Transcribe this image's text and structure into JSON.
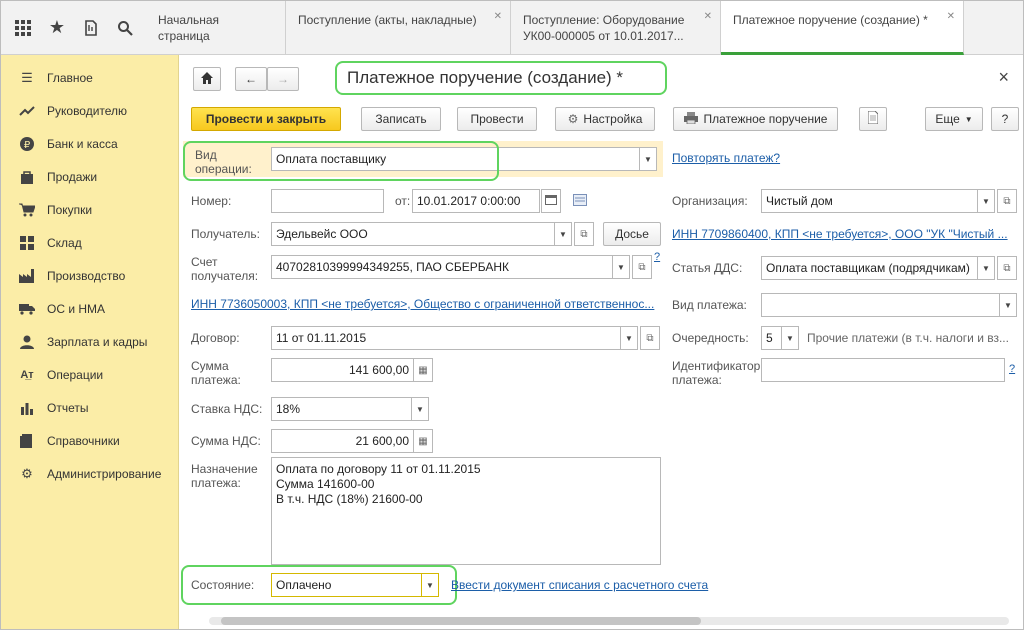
{
  "tabs": [
    {
      "label": "Начальная страница"
    },
    {
      "label": "Поступление (акты, накладные)"
    },
    {
      "label": "Поступление: Оборудование УК00-000005 от 10.01.2017..."
    },
    {
      "label": "Платежное поручение (создание) *"
    }
  ],
  "sidebar": {
    "items": [
      {
        "label": "Главное",
        "icon": "menu-icon"
      },
      {
        "label": "Руководителю",
        "icon": "trend-icon"
      },
      {
        "label": "Банк и касса",
        "icon": "ruble-icon"
      },
      {
        "label": "Продажи",
        "icon": "bag-icon"
      },
      {
        "label": "Покупки",
        "icon": "cart-icon"
      },
      {
        "label": "Склад",
        "icon": "grid-icon"
      },
      {
        "label": "Производство",
        "icon": "factory-icon"
      },
      {
        "label": "ОС и НМА",
        "icon": "truck-icon"
      },
      {
        "label": "Зарплата и кадры",
        "icon": "person-icon"
      },
      {
        "label": "Операции",
        "icon": "operations-icon"
      },
      {
        "label": "Отчеты",
        "icon": "barchart-icon"
      },
      {
        "label": "Справочники",
        "icon": "book-icon"
      },
      {
        "label": "Администрирование",
        "icon": "gear-icon"
      }
    ]
  },
  "form": {
    "title": "Платежное поручение (создание) *",
    "toolbar": {
      "post_close": "Провести и закрыть",
      "save": "Записать",
      "post": "Провести",
      "settings": "Настройка",
      "print": "Платежное поручение",
      "more": "Еще",
      "help": "?"
    },
    "operation_label": "Вид операции:",
    "operation_value": "Оплата поставщику",
    "repeat_link": "Повторять платеж?",
    "number_label": "Номер:",
    "number_value": "",
    "date_label": "от:",
    "date_value": "10.01.2017  0:00:00",
    "org_label": "Организация:",
    "org_value": "Чистый дом",
    "recipient_label": "Получатель:",
    "recipient_value": "Эдельвейс ООО",
    "dossier": "Досье",
    "inn_top_link": "ИНН 7709860400, КПП <не требуется>, ООО \"УК \"Чистый ...",
    "account_label": "Счет получателя:",
    "account_value": "40702810399994349255, ПАО СБЕРБАНК",
    "dds_label": "Статья ДДС:",
    "dds_value": "Оплата поставщикам (подрядчикам)",
    "inn_recipient_link": "ИНН 7736050003, КПП <не требуется>, Общество с ограниченной ответственнос...",
    "payment_type_label": "Вид платежа:",
    "payment_type_value": "",
    "contract_label": "Договор:",
    "contract_value": "11 от 01.11.2015",
    "priority_label": "Очередность:",
    "priority_value": "5",
    "priority_desc": "Прочие платежи (в т.ч. налоги и вз...",
    "amount_label": "Сумма платежа:",
    "amount_value": "141 600,00",
    "payment_id_label": "Идентификатор платежа:",
    "payment_id_value": "",
    "vat_rate_label": "Ставка НДС:",
    "vat_rate_value": "18%",
    "vat_sum_label": "Сумма НДС:",
    "vat_sum_value": "21 600,00",
    "purpose_label": "Назначение платежа:",
    "purpose_value": "Оплата по договору 11 от 01.11.2015\nСумма 141600-00\nВ т.ч. НДС  (18%) 21600-00",
    "status_label": "Состояние:",
    "status_value": "Оплачено",
    "writeoff_link": "Ввести документ списания с расчетного счета",
    "close_symbol": "×",
    "help_q": "?"
  }
}
